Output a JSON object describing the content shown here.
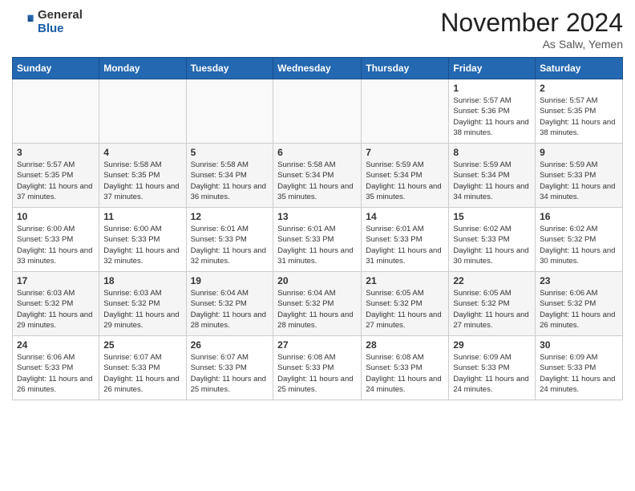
{
  "header": {
    "logo_general": "General",
    "logo_blue": "Blue",
    "month_title": "November 2024",
    "location": "As Salw, Yemen"
  },
  "weekdays": [
    "Sunday",
    "Monday",
    "Tuesday",
    "Wednesday",
    "Thursday",
    "Friday",
    "Saturday"
  ],
  "weeks": [
    [
      {
        "day": "",
        "info": ""
      },
      {
        "day": "",
        "info": ""
      },
      {
        "day": "",
        "info": ""
      },
      {
        "day": "",
        "info": ""
      },
      {
        "day": "",
        "info": ""
      },
      {
        "day": "1",
        "info": "Sunrise: 5:57 AM\nSunset: 5:36 PM\nDaylight: 11 hours and 38 minutes."
      },
      {
        "day": "2",
        "info": "Sunrise: 5:57 AM\nSunset: 5:35 PM\nDaylight: 11 hours and 38 minutes."
      }
    ],
    [
      {
        "day": "3",
        "info": "Sunrise: 5:57 AM\nSunset: 5:35 PM\nDaylight: 11 hours and 37 minutes."
      },
      {
        "day": "4",
        "info": "Sunrise: 5:58 AM\nSunset: 5:35 PM\nDaylight: 11 hours and 37 minutes."
      },
      {
        "day": "5",
        "info": "Sunrise: 5:58 AM\nSunset: 5:34 PM\nDaylight: 11 hours and 36 minutes."
      },
      {
        "day": "6",
        "info": "Sunrise: 5:58 AM\nSunset: 5:34 PM\nDaylight: 11 hours and 35 minutes."
      },
      {
        "day": "7",
        "info": "Sunrise: 5:59 AM\nSunset: 5:34 PM\nDaylight: 11 hours and 35 minutes."
      },
      {
        "day": "8",
        "info": "Sunrise: 5:59 AM\nSunset: 5:34 PM\nDaylight: 11 hours and 34 minutes."
      },
      {
        "day": "9",
        "info": "Sunrise: 5:59 AM\nSunset: 5:33 PM\nDaylight: 11 hours and 34 minutes."
      }
    ],
    [
      {
        "day": "10",
        "info": "Sunrise: 6:00 AM\nSunset: 5:33 PM\nDaylight: 11 hours and 33 minutes."
      },
      {
        "day": "11",
        "info": "Sunrise: 6:00 AM\nSunset: 5:33 PM\nDaylight: 11 hours and 32 minutes."
      },
      {
        "day": "12",
        "info": "Sunrise: 6:01 AM\nSunset: 5:33 PM\nDaylight: 11 hours and 32 minutes."
      },
      {
        "day": "13",
        "info": "Sunrise: 6:01 AM\nSunset: 5:33 PM\nDaylight: 11 hours and 31 minutes."
      },
      {
        "day": "14",
        "info": "Sunrise: 6:01 AM\nSunset: 5:33 PM\nDaylight: 11 hours and 31 minutes."
      },
      {
        "day": "15",
        "info": "Sunrise: 6:02 AM\nSunset: 5:33 PM\nDaylight: 11 hours and 30 minutes."
      },
      {
        "day": "16",
        "info": "Sunrise: 6:02 AM\nSunset: 5:32 PM\nDaylight: 11 hours and 30 minutes."
      }
    ],
    [
      {
        "day": "17",
        "info": "Sunrise: 6:03 AM\nSunset: 5:32 PM\nDaylight: 11 hours and 29 minutes."
      },
      {
        "day": "18",
        "info": "Sunrise: 6:03 AM\nSunset: 5:32 PM\nDaylight: 11 hours and 29 minutes."
      },
      {
        "day": "19",
        "info": "Sunrise: 6:04 AM\nSunset: 5:32 PM\nDaylight: 11 hours and 28 minutes."
      },
      {
        "day": "20",
        "info": "Sunrise: 6:04 AM\nSunset: 5:32 PM\nDaylight: 11 hours and 28 minutes."
      },
      {
        "day": "21",
        "info": "Sunrise: 6:05 AM\nSunset: 5:32 PM\nDaylight: 11 hours and 27 minutes."
      },
      {
        "day": "22",
        "info": "Sunrise: 6:05 AM\nSunset: 5:32 PM\nDaylight: 11 hours and 27 minutes."
      },
      {
        "day": "23",
        "info": "Sunrise: 6:06 AM\nSunset: 5:32 PM\nDaylight: 11 hours and 26 minutes."
      }
    ],
    [
      {
        "day": "24",
        "info": "Sunrise: 6:06 AM\nSunset: 5:33 PM\nDaylight: 11 hours and 26 minutes."
      },
      {
        "day": "25",
        "info": "Sunrise: 6:07 AM\nSunset: 5:33 PM\nDaylight: 11 hours and 26 minutes."
      },
      {
        "day": "26",
        "info": "Sunrise: 6:07 AM\nSunset: 5:33 PM\nDaylight: 11 hours and 25 minutes."
      },
      {
        "day": "27",
        "info": "Sunrise: 6:08 AM\nSunset: 5:33 PM\nDaylight: 11 hours and 25 minutes."
      },
      {
        "day": "28",
        "info": "Sunrise: 6:08 AM\nSunset: 5:33 PM\nDaylight: 11 hours and 24 minutes."
      },
      {
        "day": "29",
        "info": "Sunrise: 6:09 AM\nSunset: 5:33 PM\nDaylight: 11 hours and 24 minutes."
      },
      {
        "day": "30",
        "info": "Sunrise: 6:09 AM\nSunset: 5:33 PM\nDaylight: 11 hours and 24 minutes."
      }
    ]
  ]
}
